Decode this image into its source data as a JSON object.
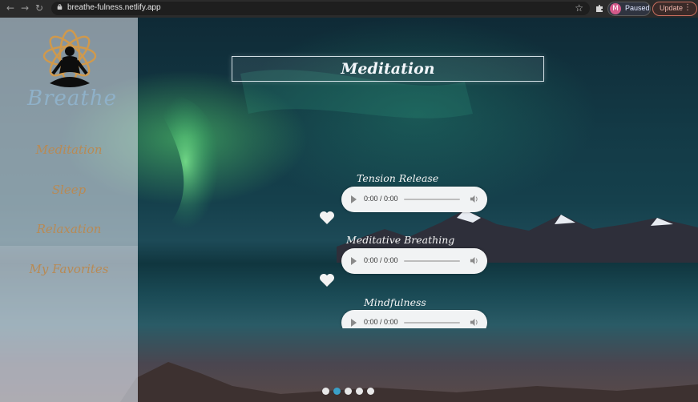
{
  "browser": {
    "url": "breathe-fulness.netlify.app",
    "profile_initial": "M",
    "profile_status": "Paused",
    "update_label": "Update"
  },
  "sidebar": {
    "logo_text": "Breathe",
    "menu": [
      {
        "label": "Meditation"
      },
      {
        "label": "Sleep"
      },
      {
        "label": "Relaxation"
      },
      {
        "label": "My Favorites"
      }
    ]
  },
  "page": {
    "title": "Meditation"
  },
  "tracks": [
    {
      "title": "Tension Release",
      "time": "0:00 / 0:00",
      "favorited": false
    },
    {
      "title": "Meditative Breathing",
      "time": "0:00 / 0:00",
      "favorited": false
    },
    {
      "title": "Mindfulness",
      "time": "0:00 / 0:00",
      "favorited": false
    }
  ],
  "carousel": {
    "count": 5,
    "active_index": 1
  },
  "colors": {
    "accent": "#3aa0c8",
    "menu_text": "#b88a54",
    "logo_text": "#8fb1c9"
  }
}
